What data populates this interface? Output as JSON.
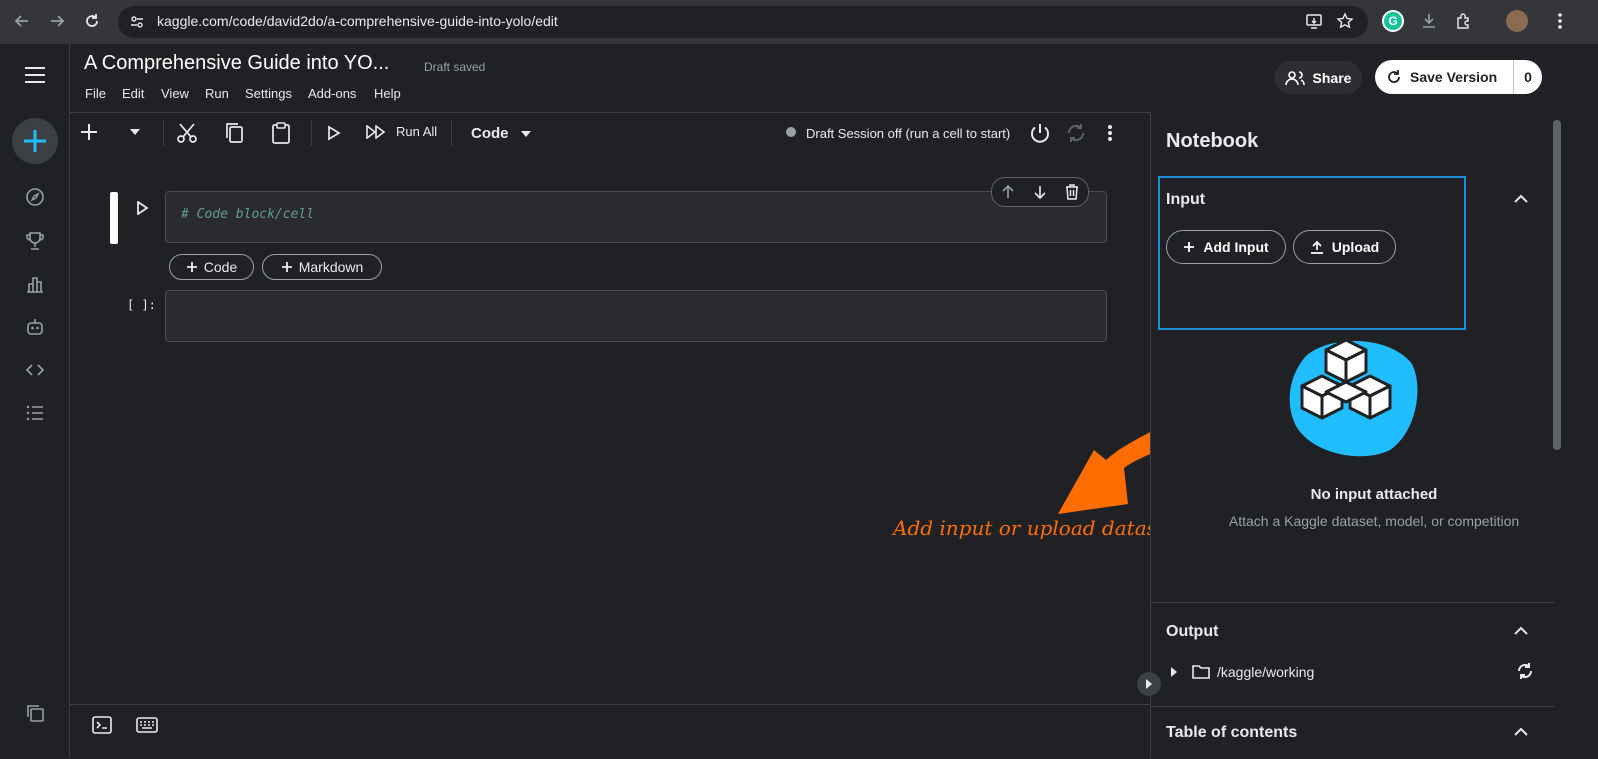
{
  "browser": {
    "url": "kaggle.com/code/david2do/a-comprehensive-guide-into-yolo/edit",
    "grammarly_letter": "G"
  },
  "header": {
    "title": "A Comprehensive Guide into YO...",
    "status": "Draft saved",
    "menu": [
      "File",
      "Edit",
      "View",
      "Run",
      "Settings",
      "Add-ons",
      "Help"
    ],
    "share_label": "Share",
    "save_label": "Save Version",
    "save_count": "0"
  },
  "toolbar": {
    "run_all_label": "Run All",
    "cell_type": "Code",
    "session_status": "Draft Session off (run a cell to start)"
  },
  "cells": {
    "cell1_code": "# Code block/cell",
    "cell2_prompt": "[ ]:",
    "add_code_label": "Code",
    "add_markdown_label": "Markdown"
  },
  "panel": {
    "title": "Notebook",
    "input_title": "Input",
    "add_input_label": "Add Input",
    "upload_label": "Upload",
    "no_input_title": "No input attached",
    "no_input_sub": "Attach a Kaggle dataset, model, or competition",
    "output_title": "Output",
    "output_path": "/kaggle/working",
    "toc_title": "Table of contents"
  },
  "annotation": {
    "text": "Add input or upload datasethere"
  },
  "colors": {
    "accent": "#20beff",
    "annotation": "#ff6d00",
    "highlight_box": "#1a8fd8"
  }
}
